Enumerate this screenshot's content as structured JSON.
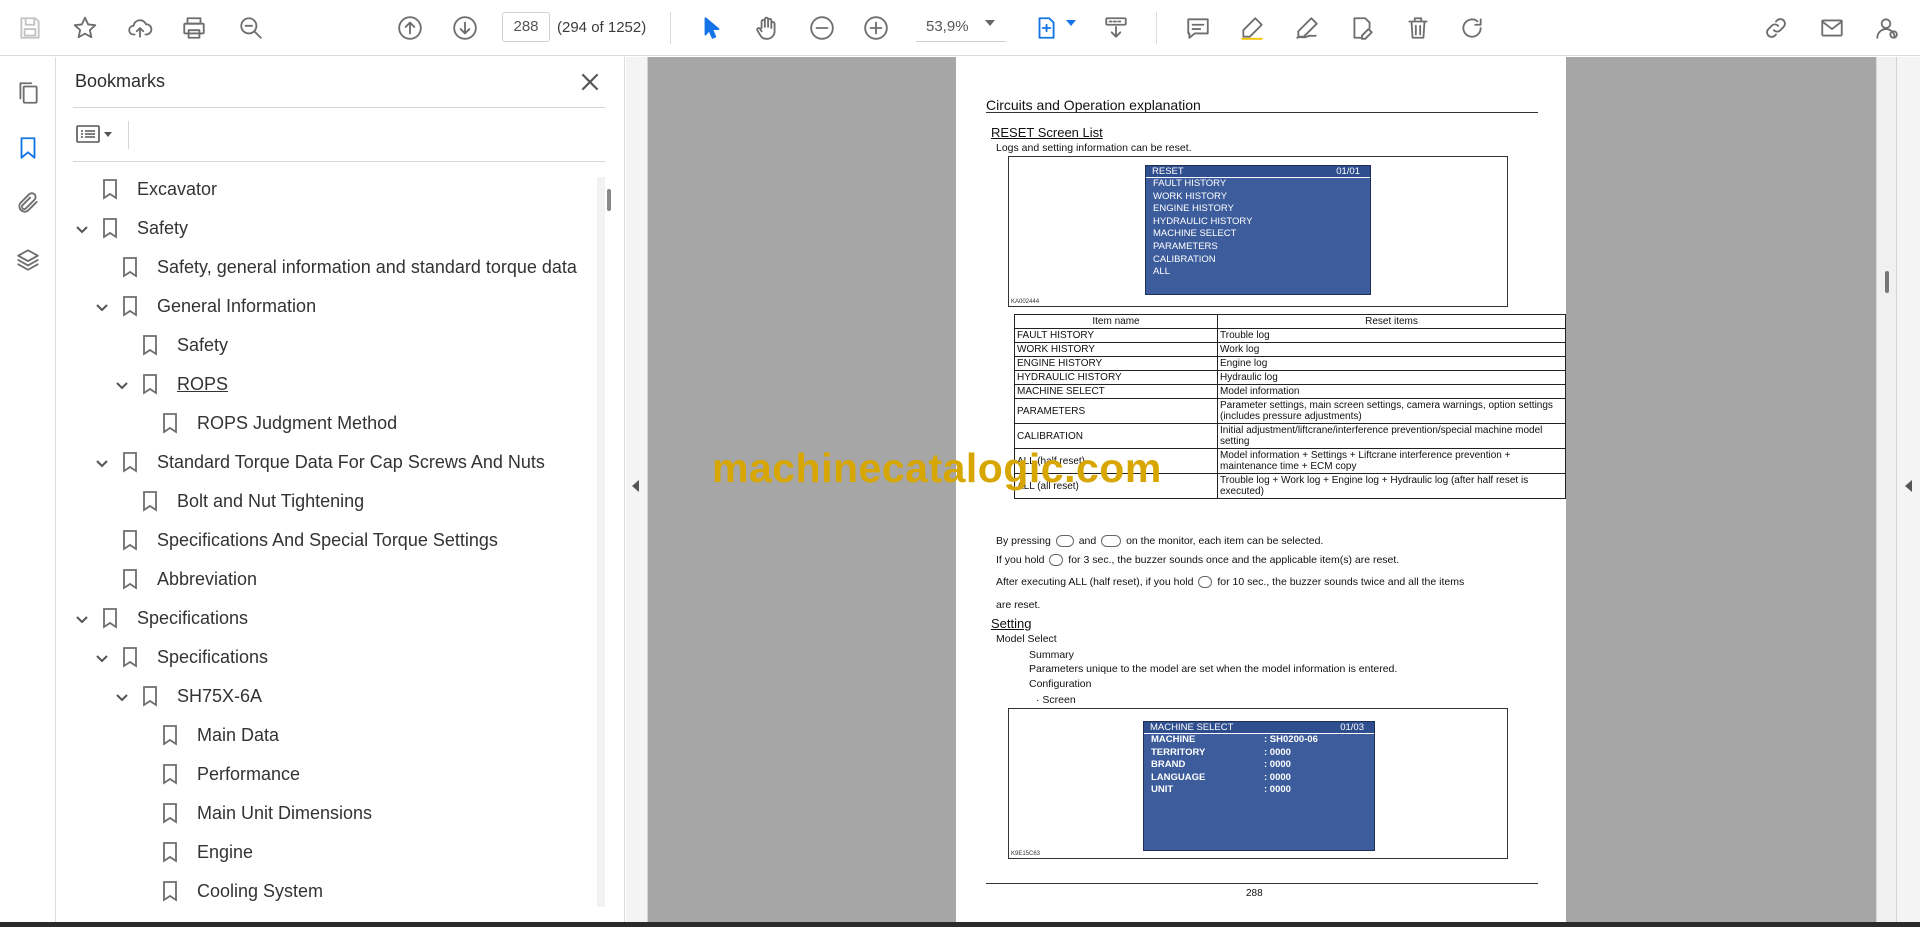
{
  "toolbar": {
    "page_number": "288",
    "page_count": "(294 of 1252)",
    "zoom": "53,9%"
  },
  "bookmarks": {
    "title": "Bookmarks",
    "items": [
      {
        "label": "Excavator",
        "level": 0,
        "expanded": null
      },
      {
        "label": "Safety",
        "level": 0,
        "expanded": true
      },
      {
        "label": "Safety, general information and standard torque data",
        "level": 1,
        "expanded": null
      },
      {
        "label": "General Information",
        "level": 1,
        "expanded": true
      },
      {
        "label": "Safety",
        "level": 2,
        "expanded": null
      },
      {
        "label": "ROPS",
        "level": 2,
        "expanded": true
      },
      {
        "label": "ROPS Judgment Method",
        "level": 3,
        "expanded": null
      },
      {
        "label": "Standard Torque Data For Cap Screws And Nuts",
        "level": 1,
        "expanded": true
      },
      {
        "label": "Bolt and Nut Tightening",
        "level": 2,
        "expanded": null
      },
      {
        "label": "Specifications And Special Torque Settings",
        "level": 1,
        "expanded": null
      },
      {
        "label": "Abbreviation",
        "level": 1,
        "expanded": null
      },
      {
        "label": "Specifications",
        "level": 0,
        "expanded": true
      },
      {
        "label": "Specifications",
        "level": 1,
        "expanded": true
      },
      {
        "label": "SH75X-6A",
        "level": 2,
        "expanded": true
      },
      {
        "label": "Main Data",
        "level": 3,
        "expanded": null
      },
      {
        "label": "Performance",
        "level": 3,
        "expanded": null
      },
      {
        "label": "Main Unit Dimensions",
        "level": 3,
        "expanded": null
      },
      {
        "label": "Engine",
        "level": 3,
        "expanded": null
      },
      {
        "label": "Cooling System",
        "level": 3,
        "expanded": null
      }
    ]
  },
  "document": {
    "header": "Circuits and Operation explanation",
    "reset_title": "RESET Screen List",
    "reset_intro": "Logs and setting information can be reset.",
    "reset_screen": {
      "title": "RESET",
      "page": "01/01",
      "items": [
        "FAULT HISTORY",
        "WORK HISTORY",
        "ENGINE HISTORY",
        "HYDRAULIC HISTORY",
        "MACHINE SELECT",
        "PARAMETERS",
        "CALIBRATION",
        "ALL"
      ],
      "figure_id": "KA002444"
    },
    "table": {
      "headers": [
        "Item name",
        "Reset items"
      ],
      "rows": [
        [
          "FAULT HISTORY",
          "Trouble log"
        ],
        [
          "WORK HISTORY",
          "Work log"
        ],
        [
          "ENGINE HISTORY",
          "Engine log"
        ],
        [
          "HYDRAULIC HISTORY",
          "Hydraulic log"
        ],
        [
          "MACHINE SELECT",
          "Model information"
        ],
        [
          "PARAMETERS",
          "Parameter settings, main screen settings, camera warnings, option settings (includes pressure adjustments)"
        ],
        [
          "CALIBRATION",
          "Initial adjustment/liftcrane/interference prevention/special machine model setting"
        ],
        [
          "ALL (half reset)",
          "Model information + Settings + Liftcrane interference prevention + maintenance time + ECM copy"
        ],
        [
          "ALL (all reset)",
          "Trouble log + Work log + Engine log + Hydraulic log (after half reset is executed)"
        ]
      ]
    },
    "note1_a": "By pressing",
    "note1_b": "and",
    "note1_c": "on the monitor, each item can be selected.",
    "note2_a": "If you hold",
    "note2_b": "for 3 sec., the buzzer sounds once and the applicable item(s) are reset.",
    "note3_a": "After executing ALL (half reset), if you hold",
    "note3_b": "for 10 sec., the buzzer sounds twice and all the items",
    "note3_c": "are reset.",
    "setting_title": "Setting",
    "model_select": "Model Select",
    "summary": "Summary",
    "summary_text": "Parameters unique to the model are set when the model information is entered.",
    "configuration": "Configuration",
    "screen_bullet": "·  Screen",
    "machine_screen": {
      "title": "MACHINE SELECT",
      "page": "01/03",
      "rows": [
        {
          "key": "MACHINE",
          "value": ": SH0200-06"
        },
        {
          "key": "TERRITORY",
          "value": ": 0000"
        },
        {
          "key": "BRAND",
          "value": ": 0000"
        },
        {
          "key": "LANGUAGE",
          "value": ": 0000"
        },
        {
          "key": "UNIT",
          "value": ": 0000"
        }
      ],
      "figure_id": "K9E15C63"
    },
    "page_number": "288"
  },
  "watermark": "machinecatalogic.com"
}
